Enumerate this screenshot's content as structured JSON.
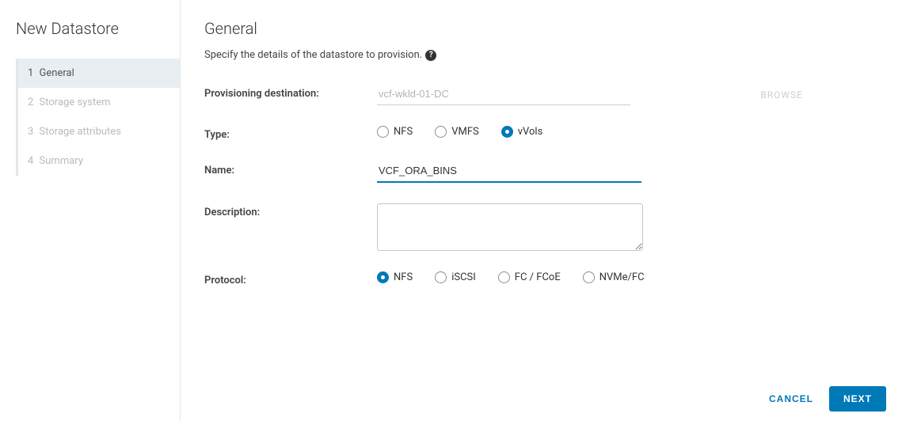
{
  "wizard": {
    "title": "New Datastore",
    "steps": [
      {
        "num": "1",
        "label": "General",
        "active": true
      },
      {
        "num": "2",
        "label": "Storage system",
        "active": false
      },
      {
        "num": "3",
        "label": "Storage attributes",
        "active": false
      },
      {
        "num": "4",
        "label": "Summary",
        "active": false
      }
    ]
  },
  "panel": {
    "title": "General",
    "subtitle": "Specify the details of the datastore to provision.",
    "help_glyph": "?"
  },
  "form": {
    "destination_label": "Provisioning destination:",
    "destination_value": "vcf-wkld-01-DC",
    "browse_label": "BROWSE",
    "type_label": "Type:",
    "type_options": [
      {
        "label": "NFS",
        "selected": false
      },
      {
        "label": "VMFS",
        "selected": false
      },
      {
        "label": "vVols",
        "selected": true
      }
    ],
    "name_label": "Name:",
    "name_value": "VCF_ORA_BINS",
    "description_label": "Description:",
    "description_value": "",
    "protocol_label": "Protocol:",
    "protocol_options": [
      {
        "label": "NFS",
        "selected": true
      },
      {
        "label": "iSCSI",
        "selected": false
      },
      {
        "label": "FC / FCoE",
        "selected": false
      },
      {
        "label": "NVMe/FC",
        "selected": false
      }
    ]
  },
  "footer": {
    "cancel": "CANCEL",
    "next": "NEXT"
  }
}
